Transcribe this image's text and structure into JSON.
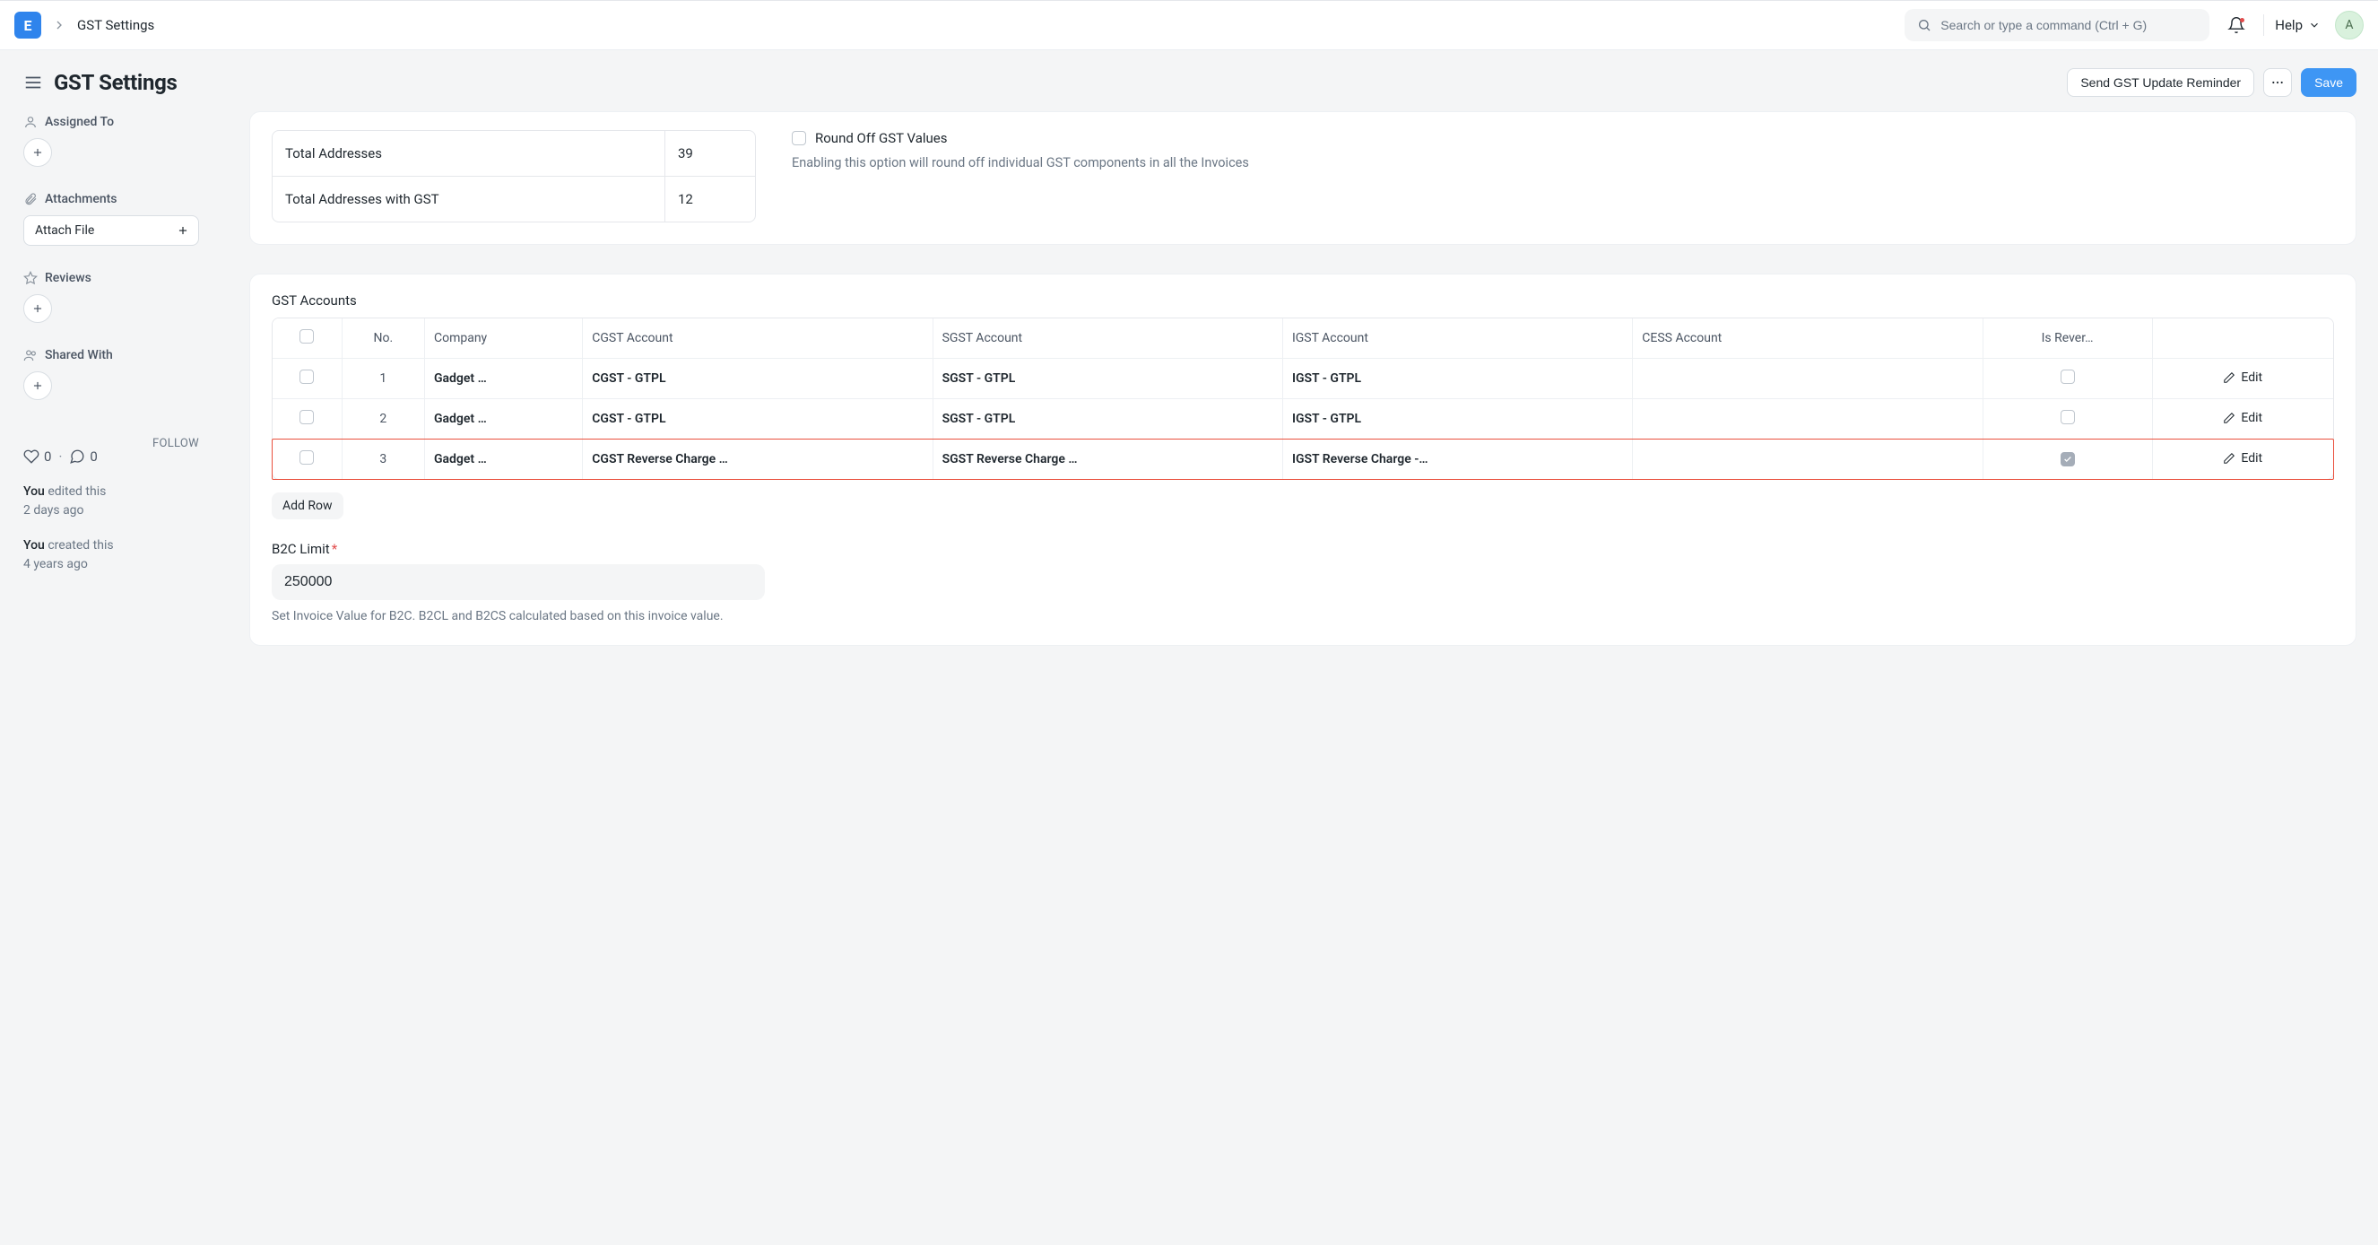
{
  "navbar": {
    "breadcrumb": "GST Settings",
    "search_placeholder": "Search or type a command (Ctrl + G)",
    "help_label": "Help",
    "avatar_initial": "A"
  },
  "page": {
    "title": "GST Settings",
    "send_reminder_label": "Send GST Update Reminder",
    "save_label": "Save"
  },
  "sidebar": {
    "assigned_to_label": "Assigned To",
    "attachments_label": "Attachments",
    "attach_file_label": "Attach File",
    "reviews_label": "Reviews",
    "shared_with_label": "Shared With",
    "likes": "0",
    "comments": "0",
    "follow_label": "FOLLOW",
    "activity": {
      "edited_prefix": "You",
      "edited_text": " edited this",
      "edited_time": "2 days ago",
      "created_prefix": "You",
      "created_text": " created this",
      "created_time": "4 years ago"
    }
  },
  "addresses": {
    "total_label": "Total Addresses",
    "total_value": "39",
    "with_gst_label": "Total Addresses with GST",
    "with_gst_value": "12"
  },
  "round_off": {
    "label": "Round Off GST Values",
    "help": "Enabling this option will round off individual GST components in all the Invoices"
  },
  "gst_accounts": {
    "title": "GST Accounts",
    "headers": {
      "no": "No.",
      "company": "Company",
      "cgst": "CGST Account",
      "sgst": "SGST Account",
      "igst": "IGST Account",
      "cess": "CESS Account",
      "reverse": "Is Rever…",
      "edit": "Edit"
    },
    "rows": [
      {
        "no": "1",
        "company": "Gadget …",
        "cgst": "CGST - GTPL",
        "sgst": "SGST - GTPL",
        "igst": "IGST - GTPL",
        "cess": "",
        "reverse": false
      },
      {
        "no": "2",
        "company": "Gadget …",
        "cgst": "CGST - GTPL",
        "sgst": "SGST - GTPL",
        "igst": "IGST - GTPL",
        "cess": "",
        "reverse": false
      },
      {
        "no": "3",
        "company": "Gadget …",
        "cgst": "CGST Reverse Charge …",
        "sgst": "SGST Reverse Charge …",
        "igst": "IGST Reverse Charge -…",
        "cess": "",
        "reverse": true
      }
    ],
    "add_row_label": "Add Row"
  },
  "b2c": {
    "label": "B2C Limit",
    "value": "250000",
    "help": "Set Invoice Value for B2C. B2CL and B2CS calculated based on this invoice value."
  }
}
